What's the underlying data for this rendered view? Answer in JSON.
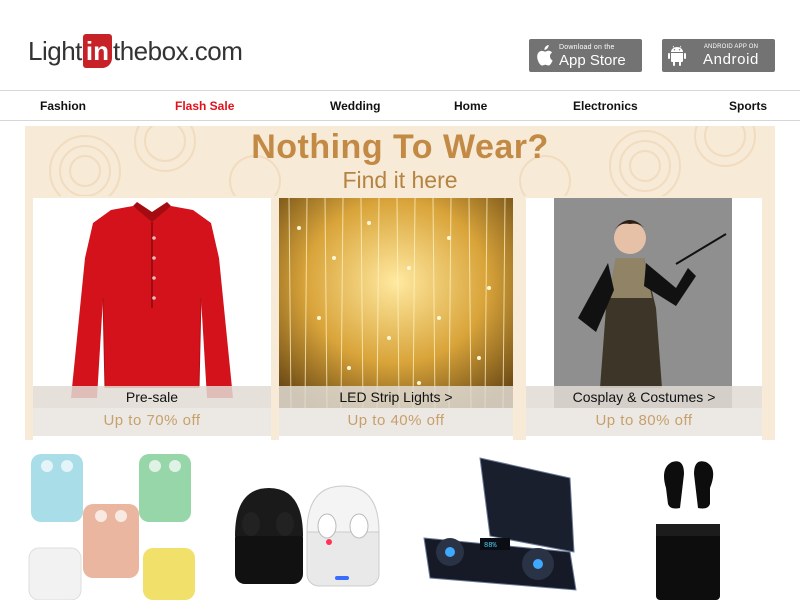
{
  "header": {
    "logo": {
      "part1": "Light",
      "part2": "in",
      "part3": "thebox",
      "part4": ".com"
    },
    "app_store": {
      "small": "Download on the",
      "big": "App Store",
      "icon": "apple-icon"
    },
    "android": {
      "small": "ANDROID APP ON",
      "big": "Android",
      "icon": "android-icon"
    }
  },
  "nav": {
    "items": [
      {
        "label": "Fashion"
      },
      {
        "label": "Flash Sale",
        "highlight": true,
        "color": "#e4101b"
      },
      {
        "label": "Wedding"
      },
      {
        "label": "Home"
      },
      {
        "label": "Electronics"
      },
      {
        "label": "Sports"
      }
    ]
  },
  "promo": {
    "headline": "Nothing To Wear?",
    "subline": "Find it here",
    "cards": [
      {
        "caption": "Pre-sale",
        "offer": "Up to 70% off",
        "image": "red-henley-shirt"
      },
      {
        "caption": "LED Strip Lights >",
        "offer": "Up to 40% off",
        "image": "warm-led-curtain-lights"
      },
      {
        "caption": "Cosplay & Costumes >",
        "offer": "Up to 80% off",
        "image": "flapper-costume-model"
      }
    ]
  },
  "products": [
    {
      "image": "pastel-earbuds-cases"
    },
    {
      "image": "black-and-white-earbuds"
    },
    {
      "image": "wireless-earbuds-powerbank"
    },
    {
      "image": "black-earbuds-case"
    }
  ],
  "colors": {
    "brand_red": "#c62227",
    "flash_red": "#e4101b",
    "promo_gold": "#c28a45",
    "promo_bg": "#f7ead6",
    "app_button": "#737373"
  }
}
